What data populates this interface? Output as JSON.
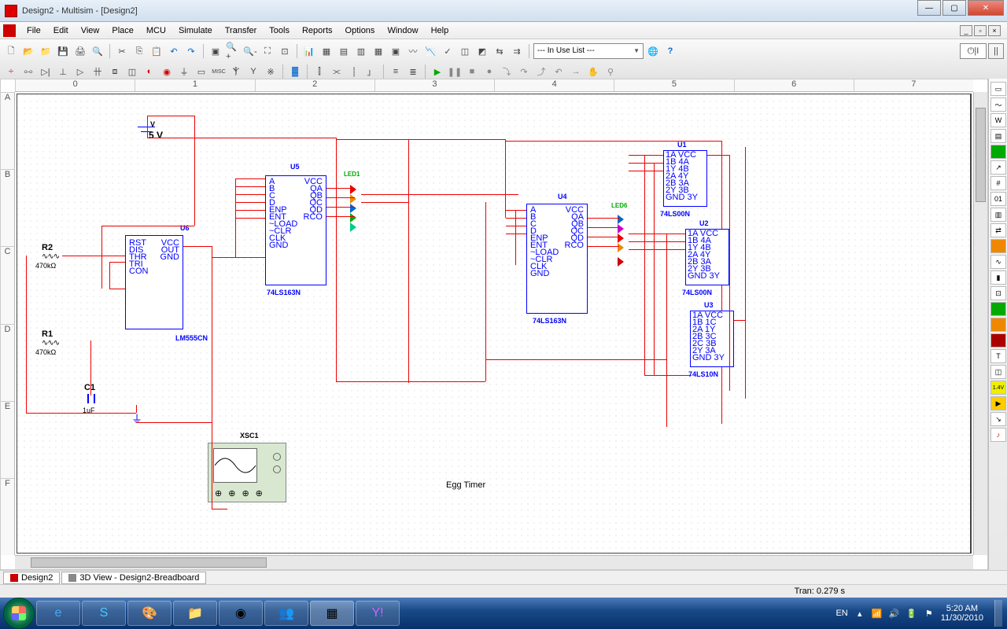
{
  "title": "Design2 - Multisim - [Design2]",
  "menu": [
    "File",
    "Edit",
    "View",
    "Place",
    "MCU",
    "Simulate",
    "Transfer",
    "Tools",
    "Reports",
    "Options",
    "Window",
    "Help"
  ],
  "combo": "--- In Use List ---",
  "ruler_h": [
    "0",
    "1",
    "2",
    "3",
    "4",
    "5",
    "6",
    "7"
  ],
  "ruler_v": [
    "A",
    "B",
    "C",
    "D",
    "E",
    "F"
  ],
  "doctabs": {
    "a": "Design2",
    "b": "3D View - Design2-Breadboard"
  },
  "status": {
    "tran": "Tran: 0.279 s"
  },
  "tray": {
    "lang": "EN",
    "time": "5:20 AM",
    "date": "11/30/2010"
  },
  "schematic": {
    "title": "Egg Timer",
    "power": {
      "label": "V",
      "value": "5 V"
    },
    "r1": {
      "name": "R1",
      "val": "470kΩ"
    },
    "r2": {
      "name": "R2",
      "val": "470kΩ"
    },
    "c1": {
      "name": "C1",
      "val": "1uF"
    },
    "u6": {
      "name": "U6",
      "part": "LM555CN",
      "pins_l": [
        "RST",
        "DIS",
        "THR",
        "TRI",
        "CON"
      ],
      "pins_r": [
        "VCC",
        "OUT",
        "",
        "",
        "GND"
      ]
    },
    "u5": {
      "name": "U5",
      "part": "74LS163N",
      "pins_l": [
        "A",
        "B",
        "C",
        "D",
        "ENP",
        "ENT",
        "~LOAD",
        "~CLR",
        "CLK",
        "GND"
      ],
      "pins_r": [
        "VCC",
        "QA",
        "QB",
        "QC",
        "QD",
        "",
        "",
        "RCO"
      ]
    },
    "u4": {
      "name": "U4",
      "part": "74LS163N",
      "pins_l": [
        "A",
        "B",
        "C",
        "D",
        "ENP",
        "ENT",
        "~LOAD",
        "~CLR",
        "CLK",
        "GND"
      ],
      "pins_r": [
        "VCC",
        "QA",
        "QB",
        "QC",
        "QD",
        "",
        "",
        "RCO"
      ]
    },
    "u1": {
      "name": "U1",
      "part": "74LS00N",
      "pins": [
        "1A  VCC",
        "1B  4A",
        "1Y  4B",
        "2A  4Y",
        "2B  3A",
        "2Y  3B",
        "GND 3Y"
      ]
    },
    "u2": {
      "name": "U2",
      "part": "74LS00N",
      "pins": [
        "1A  VCC",
        "1B  4A",
        "1Y  4B",
        "2A  4Y",
        "2B  3A",
        "2Y  3B",
        "GND 3Y"
      ]
    },
    "u3": {
      "name": "U3",
      "part": "74LS10N",
      "pins": [
        "1A  VCC",
        "1B  1C",
        "2A  1Y",
        "2B  3C",
        "2C  3B",
        "2Y  3A",
        "GND 3Y"
      ]
    },
    "scope": {
      "name": "XSC1"
    },
    "leds1": "LED1",
    "leds2": "LED6"
  }
}
